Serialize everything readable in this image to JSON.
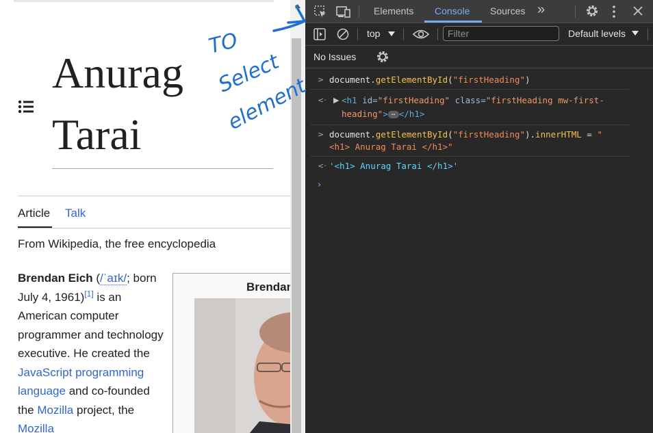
{
  "wiki": {
    "heading_line1": "Anurag",
    "heading_line2": "Tarai",
    "tabs": {
      "article": "Article",
      "talk": "Talk"
    },
    "tagline": "From Wikipedia, the free encyclopedia",
    "body": {
      "name": "Brendan Eich",
      "ipa_open": " (",
      "ipa": "/ˈaɪk/",
      "born": "; born July 4, 1961)",
      "ref": "[1]",
      "text1": " is an American computer programmer and technology executive. He created the ",
      "link_js": "JavaScript programming language",
      "text2": " and co-founded the ",
      "link_mozilla1": "Mozilla",
      "text3": " project, the ",
      "link_mozilla2": "Mozilla"
    },
    "infobox_title": "Brendan Eich"
  },
  "annotation": {
    "text_line1": "TO",
    "text_line2": "Select",
    "text_line3": "element",
    "color": "#1f6fd1"
  },
  "devtools": {
    "tabs": {
      "elements": "Elements",
      "console": "Console",
      "sources": "Sources",
      "more": "»"
    },
    "context": "top",
    "filter_placeholder": "Filter",
    "levels": "Default levels",
    "issues": "No Issues",
    "console": {
      "line1": {
        "obj": "document.",
        "fn": "getElementById",
        "open": "(",
        "arg": "\"firstHeading\"",
        "close": ")"
      },
      "result1": {
        "tag_open": "<h1",
        "attr1": " id=",
        "val1": "\"firstHeading\"",
        "attr2": " class=",
        "val2_a": "\"firstHeading mw-first-",
        "val2_b": "heading\"",
        "gt": ">",
        "ellipsis": "…",
        "tag_close": "</h1>"
      },
      "line2": {
        "obj": "document.",
        "fn": "getElementById",
        "open": "(",
        "arg": "\"firstHeading\"",
        "mid": ").",
        "prop": "innerHTML",
        "eq": " = ",
        "str_a": "\"",
        "str_b": "<h1> Anurag Tarai </h1>\""
      },
      "result2": "'<h1> Anurag Tarai </h1>'"
    }
  }
}
